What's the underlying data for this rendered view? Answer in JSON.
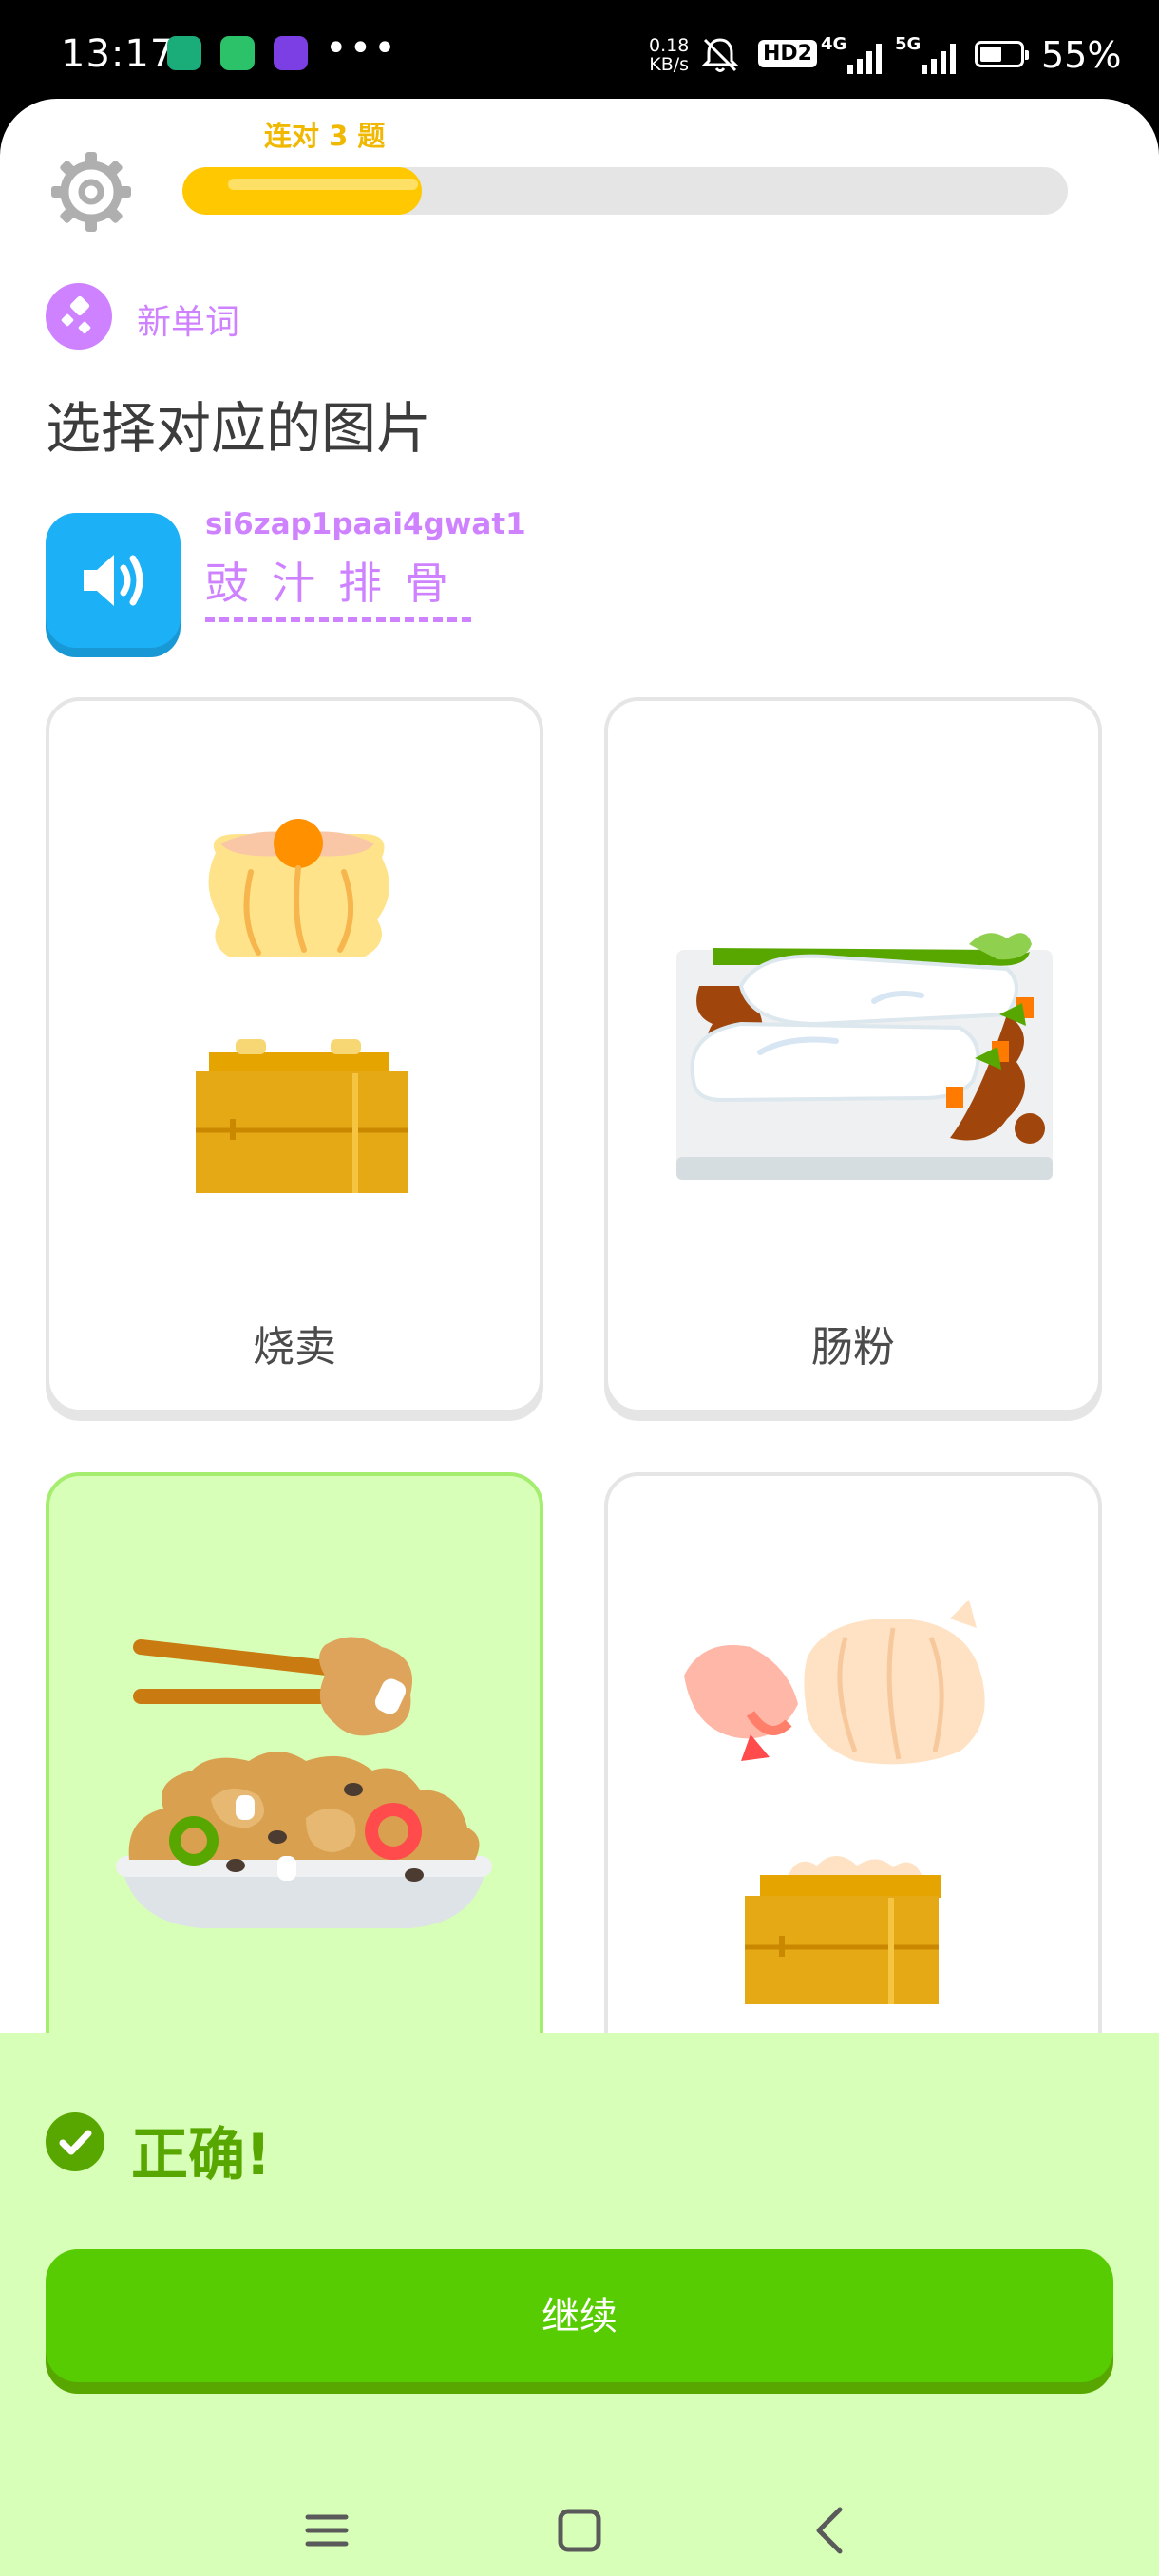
{
  "status_bar": {
    "time": "13:17",
    "dots": "•••",
    "speed_value": "0.18",
    "speed_unit": "KB/s",
    "hd_badge": "HD2",
    "network_1": "4G",
    "network_2": "5G",
    "battery_percent": "55%",
    "battery_level": 0.55
  },
  "header": {
    "streak_text": "连对 3 题",
    "progress_fraction": 0.27
  },
  "badge": {
    "label": "新单词"
  },
  "prompt": {
    "title": "选择对应的图片",
    "romanization": "si6zap1paai4gwat1",
    "hanzi": "豉汁排骨"
  },
  "options": [
    {
      "label": "烧卖",
      "selected": false
    },
    {
      "label": "肠粉",
      "selected": false
    },
    {
      "label": "",
      "selected": true
    },
    {
      "label": "",
      "selected": false
    }
  ],
  "feedback": {
    "title": "正确!",
    "continue_label": "继续"
  },
  "colors": {
    "accent_green": "#58cc02",
    "dark_green": "#58a700",
    "light_green": "#d7ffb8",
    "purple": "#ce82ff",
    "blue": "#1cb0f6",
    "progress_yellow": "#ffc800"
  }
}
